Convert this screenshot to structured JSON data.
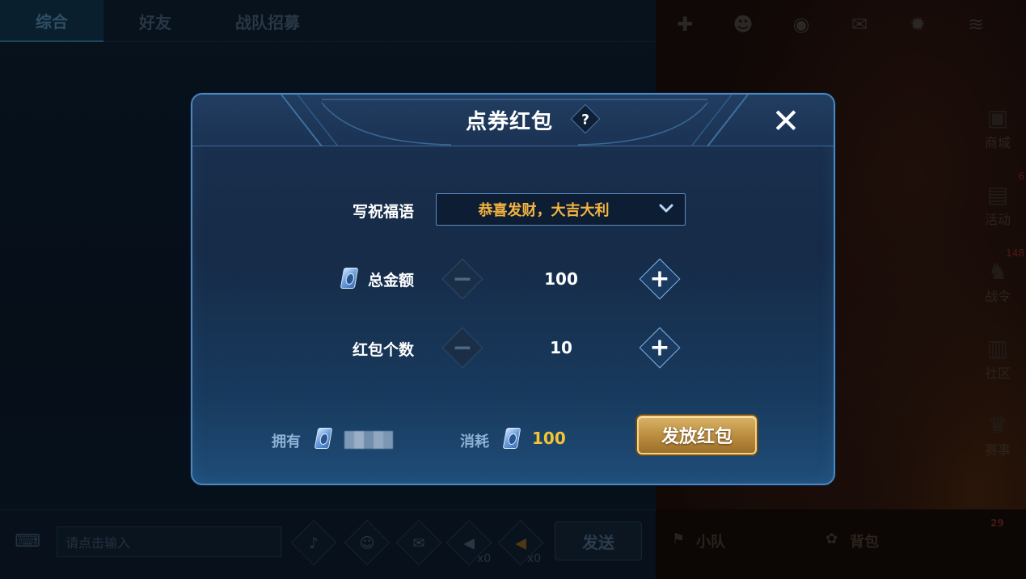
{
  "chat": {
    "tabs": [
      {
        "label": "综合",
        "active": true
      },
      {
        "label": "好友",
        "active": false
      },
      {
        "label": "战队招募",
        "active": false
      }
    ],
    "input_placeholder": "请点击输入",
    "send_label": "发送",
    "horn_count": "x0",
    "gold_horn_count": "x0"
  },
  "side_menu": {
    "items": [
      {
        "label": "商城",
        "icon": "shop-icon",
        "badge": ""
      },
      {
        "label": "活动",
        "icon": "activity-icon",
        "badge": "6"
      },
      {
        "label": "战令",
        "icon": "battle-pass-icon",
        "badge": "148"
      },
      {
        "label": "社区",
        "icon": "community-icon",
        "badge": ""
      },
      {
        "label": "赛事",
        "icon": "trophy-icon",
        "badge": ""
      }
    ]
  },
  "bottom_bar": {
    "team_label": "小队",
    "bag_label": "背包",
    "badge": "29"
  },
  "dialog": {
    "title": "点券红包",
    "help_symbol": "?",
    "close_symbol": "✕",
    "blessing": {
      "label": "写祝福语",
      "value": "恭喜发财，大吉大利"
    },
    "total_amount": {
      "label": "总金额",
      "value": "100"
    },
    "packet_count": {
      "label": "红包个数",
      "value": "10"
    },
    "footer": {
      "owned_label": "拥有",
      "cost_label": "消耗",
      "cost_value": "100",
      "send_button": "发放红包"
    },
    "colors": {
      "accent_gold": "#f5c531",
      "blessing_text": "#f3b441",
      "border": "#4b86bd"
    }
  }
}
